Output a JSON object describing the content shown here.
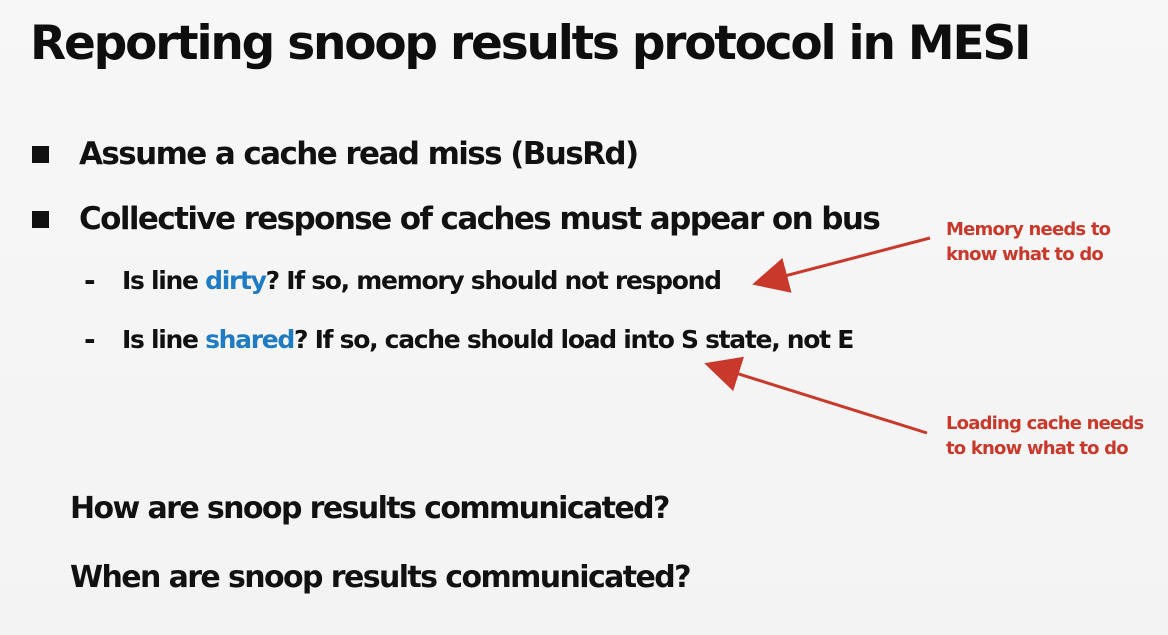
{
  "slide": {
    "title": "Reporting snoop results protocol in MESI",
    "bullets": [
      {
        "text": "Assume a cache read miss (BusRd)"
      },
      {
        "text": "Collective response of caches must appear on bus"
      }
    ],
    "subbullets": [
      {
        "prefix": "Is line ",
        "highlight": "dirty",
        "suffix": "? If so, memory should not respond"
      },
      {
        "prefix": "Is line ",
        "highlight": "shared",
        "suffix": "? If so, cache should load into S state, not E"
      }
    ],
    "annotations": [
      {
        "line1": "Memory needs to",
        "line2": "know what to do"
      },
      {
        "line1": "Loading cache needs",
        "line2": "to know what to do"
      }
    ],
    "questions": [
      "How are snoop results communicated?",
      "When are snoop results communicated?"
    ]
  },
  "colors": {
    "text": "#111111",
    "highlight_blue": "#1e7bc4",
    "annotation_red": "#c9392b",
    "background": "#f5f5f5"
  }
}
